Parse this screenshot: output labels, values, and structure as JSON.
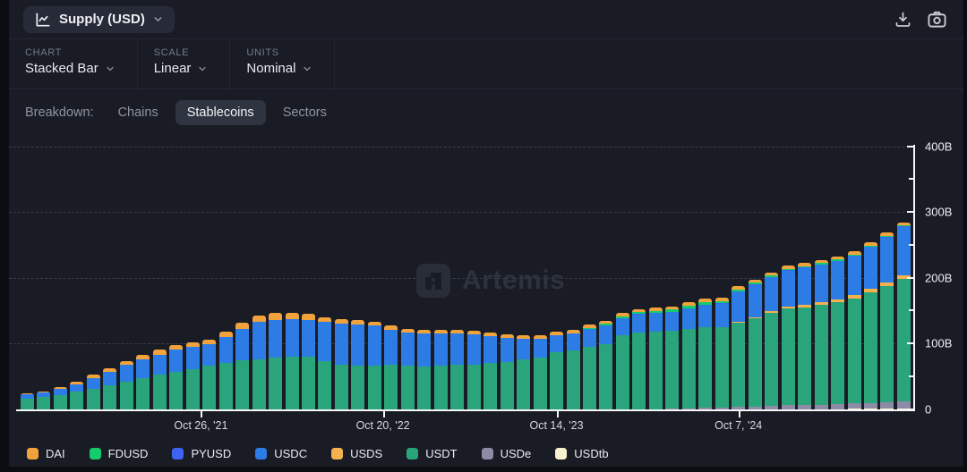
{
  "header": {
    "metric_label": "Supply (USD)"
  },
  "controls": [
    {
      "label": "CHART",
      "value": "Stacked Bar"
    },
    {
      "label": "SCALE",
      "value": "Linear"
    },
    {
      "label": "UNITS",
      "value": "Nominal"
    }
  ],
  "breakdown": {
    "label": "Breakdown:",
    "options": [
      {
        "label": "Chains",
        "active": false
      },
      {
        "label": "Stablecoins",
        "active": true
      },
      {
        "label": "Sectors",
        "active": false
      }
    ]
  },
  "watermark": {
    "text": "Artemis"
  },
  "chart_data": {
    "type": "bar",
    "stacked": true,
    "title": "Stablecoin Supply (USD), stacked by asset",
    "unit": "billions USD",
    "ylim": [
      0,
      400
    ],
    "grid": "dashed horizontal at 100B steps",
    "legend_position": "bottom",
    "y_ticks": [
      {
        "label": "0",
        "value": 0
      },
      {
        "label": "100B",
        "value": 100
      },
      {
        "label": "200B",
        "value": 200
      },
      {
        "label": "300B",
        "value": 300
      },
      {
        "label": "400B",
        "value": 400
      }
    ],
    "x_ticks": [
      {
        "label": "Oct 26, '21",
        "at_bar": 10.5
      },
      {
        "label": "Oct 20, '22",
        "at_bar": 21.5
      },
      {
        "label": "Oct 14, '23",
        "at_bar": 32
      },
      {
        "label": "Oct 7, '24",
        "at_bar": 43
      }
    ],
    "series": [
      {
        "name": "USDtb",
        "color": "#f8f1cf",
        "values": [
          0,
          0,
          0,
          0,
          0,
          0,
          0,
          0,
          0,
          0,
          0,
          0,
          0,
          0,
          0,
          0,
          0,
          0,
          0,
          0,
          0,
          0,
          0,
          0,
          0,
          0,
          0,
          0,
          0,
          0,
          0,
          0,
          0,
          0,
          0,
          0,
          0,
          0,
          0,
          0,
          0,
          0,
          0,
          0,
          0,
          0,
          0,
          0,
          0,
          0,
          0.5,
          0.5,
          0.5,
          1
        ]
      },
      {
        "name": "USDe",
        "color": "#8e8ba6",
        "values": [
          0,
          0,
          0,
          0,
          0,
          0,
          0,
          0,
          0,
          0,
          0,
          0,
          0,
          0,
          0,
          0,
          0,
          0,
          0,
          0,
          0,
          0,
          0,
          0,
          0,
          0,
          0,
          0,
          0,
          0,
          0,
          0,
          0,
          0,
          0,
          0,
          0,
          0,
          0,
          0.5,
          1,
          2,
          2.5,
          3,
          4,
          5,
          5.5,
          6,
          6.5,
          7,
          8,
          9,
          10,
          11
        ]
      },
      {
        "name": "USDT",
        "color": "#2aa47a",
        "values": [
          16,
          18,
          21,
          26,
          31,
          36,
          42,
          47,
          52,
          56,
          60,
          66,
          70,
          74,
          76,
          78,
          79,
          79,
          73,
          68,
          66,
          66,
          68,
          66,
          65,
          66,
          67,
          68,
          70,
          72,
          75,
          78,
          86,
          89,
          94,
          99,
          112,
          117,
          118,
          119,
          121,
          122,
          122,
          128,
          134,
          141,
          147,
          149,
          152,
          156,
          160,
          168,
          177,
          186
        ]
      },
      {
        "name": "USDS",
        "color": "#f6b14f",
        "values": [
          0,
          0,
          0,
          0,
          0,
          0,
          0,
          0,
          0,
          0,
          0,
          0,
          0,
          0,
          0,
          0,
          0,
          0,
          0,
          0,
          0,
          0,
          0,
          0,
          0,
          0,
          0,
          0,
          0,
          0,
          0,
          0,
          0,
          0,
          0,
          0,
          0,
          0,
          0,
          0,
          0,
          0,
          0,
          1.5,
          2,
          2.5,
          3,
          3.5,
          4,
          4,
          4.5,
          5,
          5.5,
          6
        ]
      },
      {
        "name": "USDC",
        "color": "#2d7ce5",
        "values": [
          6,
          7,
          9,
          12,
          16,
          20,
          25,
          28,
          31,
          34,
          34,
          33,
          40,
          48,
          56,
          58,
          58,
          57,
          60,
          62,
          63,
          61,
          53,
          50,
          50,
          49,
          48,
          46,
          41,
          36,
          32,
          29,
          26,
          26,
          28,
          28,
          26,
          27,
          28,
          28,
          31,
          34,
          36,
          46,
          49,
          52,
          55,
          56,
          57,
          58,
          60,
          64,
          68,
          73
        ]
      },
      {
        "name": "PYUSD",
        "color": "#3e63f2",
        "values": [
          0,
          0,
          0,
          0,
          0,
          0,
          0,
          0,
          0,
          0,
          0,
          0,
          0,
          0,
          0,
          0,
          0,
          0,
          0,
          0,
          0,
          0,
          0,
          0,
          0,
          0,
          0,
          0,
          0,
          0,
          0,
          0,
          0,
          0,
          0,
          0.3,
          0.3,
          0.3,
          0.4,
          0.4,
          0.4,
          0.4,
          0.5,
          0.5,
          0.5,
          0.6,
          0.6,
          0.7,
          0.7,
          0.8,
          0.8,
          0.9,
          1,
          1
        ]
      },
      {
        "name": "FDUSD",
        "color": "#14cc6e",
        "values": [
          0,
          0,
          0,
          0,
          0,
          0,
          0,
          0,
          0,
          0,
          0,
          0,
          0,
          0,
          0,
          0,
          0,
          0,
          0,
          0,
          0,
          0,
          0,
          0,
          0,
          0,
          0,
          0,
          0,
          0,
          0,
          0,
          0.3,
          0.5,
          1.5,
          2,
          2.5,
          3,
          3,
          3.5,
          4,
          4.5,
          3.5,
          3,
          2.5,
          2,
          2,
          2,
          2,
          1.8,
          1.5,
          1.5,
          1.2,
          1
        ]
      },
      {
        "name": "DAI",
        "color": "#f1a23c",
        "values": [
          2,
          2,
          3,
          4,
          5,
          6,
          6,
          7,
          7,
          7,
          7,
          7,
          8,
          10,
          10,
          10,
          9,
          9,
          7,
          7,
          7,
          6,
          6,
          6,
          6,
          5,
          5,
          5,
          5,
          5,
          5,
          5,
          5,
          5,
          5,
          5,
          5,
          5,
          5,
          5,
          5,
          5,
          5,
          5,
          5,
          5,
          5,
          5,
          5,
          5,
          5,
          5,
          5,
          5
        ]
      }
    ]
  },
  "legend": [
    {
      "label": "DAI",
      "color": "#f1a23c"
    },
    {
      "label": "FDUSD",
      "color": "#14cc6e"
    },
    {
      "label": "PYUSD",
      "color": "#3e63f2"
    },
    {
      "label": "USDC",
      "color": "#2d7ce5"
    },
    {
      "label": "USDS",
      "color": "#f6b14f"
    },
    {
      "label": "USDT",
      "color": "#2aa47a"
    },
    {
      "label": "USDe",
      "color": "#8e8ba6"
    },
    {
      "label": "USDtb",
      "color": "#f8f1cf"
    }
  ]
}
